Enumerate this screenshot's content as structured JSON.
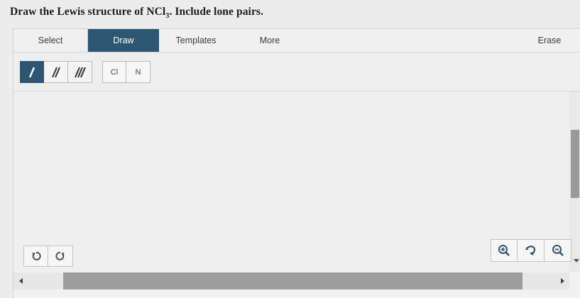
{
  "question": {
    "prefix": "Draw the Lewis structure of NCl",
    "subscript": "3",
    "suffix": ". Include lone pairs."
  },
  "tabs": {
    "select": "Select",
    "draw": "Draw",
    "templates": "Templates",
    "more": "More",
    "erase": "Erase",
    "active": "Draw"
  },
  "bond_tools": [
    "single-bond-icon",
    "double-bond-icon",
    "triple-bond-icon"
  ],
  "atoms": [
    "Cl",
    "N"
  ],
  "controls": {
    "undo": "undo-icon",
    "redo": "redo-icon",
    "zoom_in": "zoom-in-icon",
    "reset": "reset-view-icon",
    "zoom_out": "zoom-out-icon"
  },
  "colors": {
    "accent": "#2d5672",
    "background": "#ececec"
  }
}
